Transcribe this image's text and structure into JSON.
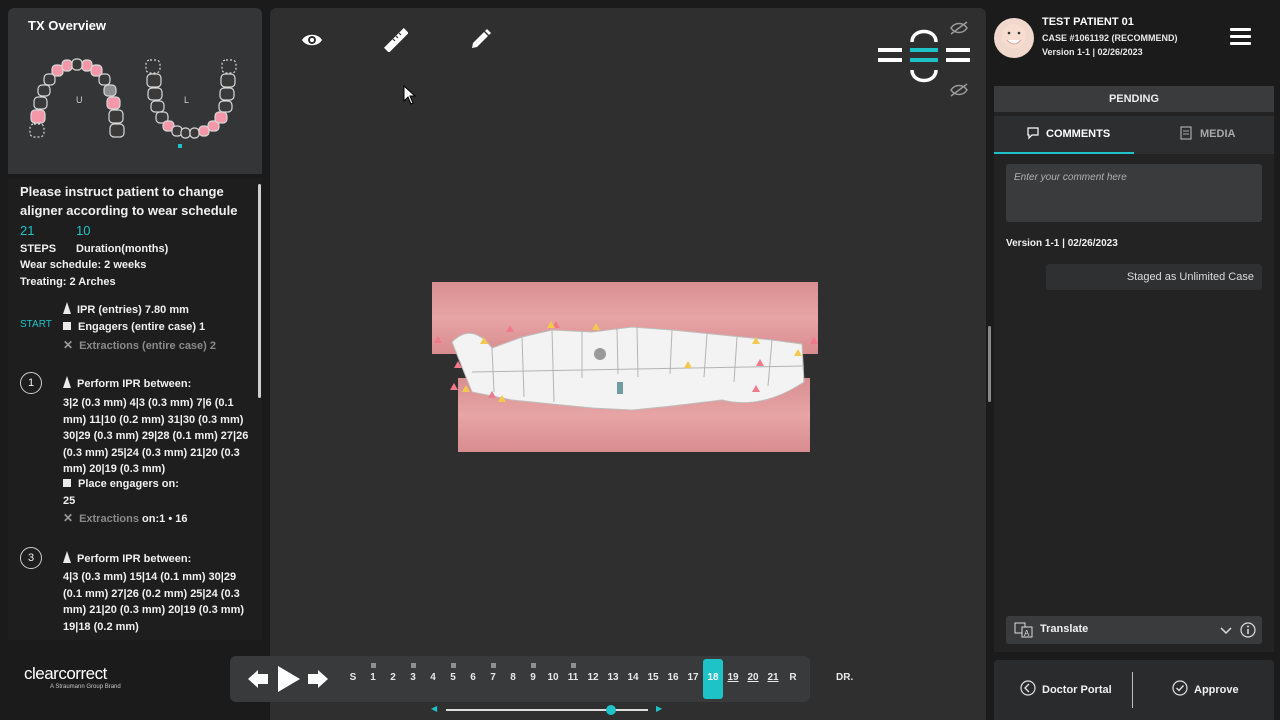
{
  "tx_overview": {
    "title": "TX Overview",
    "upper_label": "U",
    "lower_label": "L"
  },
  "instructions": {
    "heading": "Please instruct patient to change aligner according to wear schedule",
    "steps_value": "21",
    "duration_value": "10",
    "steps_label": "STEPS",
    "duration_label": "Duration(months)",
    "wear_schedule": "Wear schedule: 2 weeks",
    "treating": "Treating: 2 Arches",
    "start_label": "START",
    "ipr_entries": "IPR (entries) 7.80 mm",
    "engagers": "Engagers (entire case) 1",
    "extractions": "Extractions (entire case) 2",
    "step1": {
      "number": "1",
      "ipr_title": "Perform IPR between:",
      "ipr_details": "3|2 (0.3 mm) 4|3 (0.3 mm) 7|6 (0.1 mm) 11|10 (0.2 mm) 31|30 (0.3 mm) 30|29 (0.3 mm) 29|28 (0.1 mm) 27|26 (0.3 mm) 25|24 (0.3 mm) 21|20 (0.3 mm) 20|19 (0.3 mm)",
      "engagers_title": "Place engagers on:",
      "engagers_details": "25",
      "extractions_label": "Extractions",
      "extractions_details": "on:1 • 16"
    },
    "step3": {
      "number": "3",
      "ipr_title": "Perform IPR between:",
      "ipr_details": "4|3 (0.3 mm) 15|14 (0.1 mm) 30|29 (0.1 mm) 27|26 (0.2 mm) 25|24 (0.3 mm) 21|20 (0.3 mm) 20|19 (0.3 mm) 19|18 (0.2 mm)"
    }
  },
  "brand": {
    "name": "clearcorrect",
    "tagline": "A Straumann Group Brand"
  },
  "toolbar": {
    "view_icon": "eye-icon",
    "measure_icon": "ruler-icon",
    "draw_icon": "pencil-icon"
  },
  "timeline": {
    "steps": [
      "S",
      "1",
      "2",
      "3",
      "4",
      "5",
      "6",
      "7",
      "8",
      "9",
      "10",
      "11",
      "12",
      "13",
      "14",
      "15",
      "16",
      "17",
      "18",
      "19",
      "20",
      "21",
      "R"
    ],
    "active": "18",
    "dr_label": "DR."
  },
  "patient": {
    "name": "TEST PATIENT 01",
    "case": "CASE #1061192 (RECOMMEND)",
    "version": "Version 1-1 | 02/26/2023"
  },
  "panel": {
    "status": "PENDING",
    "tab_comments": "COMMENTS",
    "tab_media": "MEDIA",
    "comment_placeholder": "Enter your comment here",
    "version_line": "Version 1-1 | 02/26/2023",
    "staged_note": "Staged as Unlimited Case",
    "translate_label": "Translate"
  },
  "actions": {
    "doctor_portal": "Doctor Portal",
    "approve": "Approve"
  },
  "colors": {
    "accent": "#1ec3c8",
    "gum": "#e79fa0",
    "ipr_marker": "#f07a8a",
    "engager_marker": "#f2c94c"
  }
}
